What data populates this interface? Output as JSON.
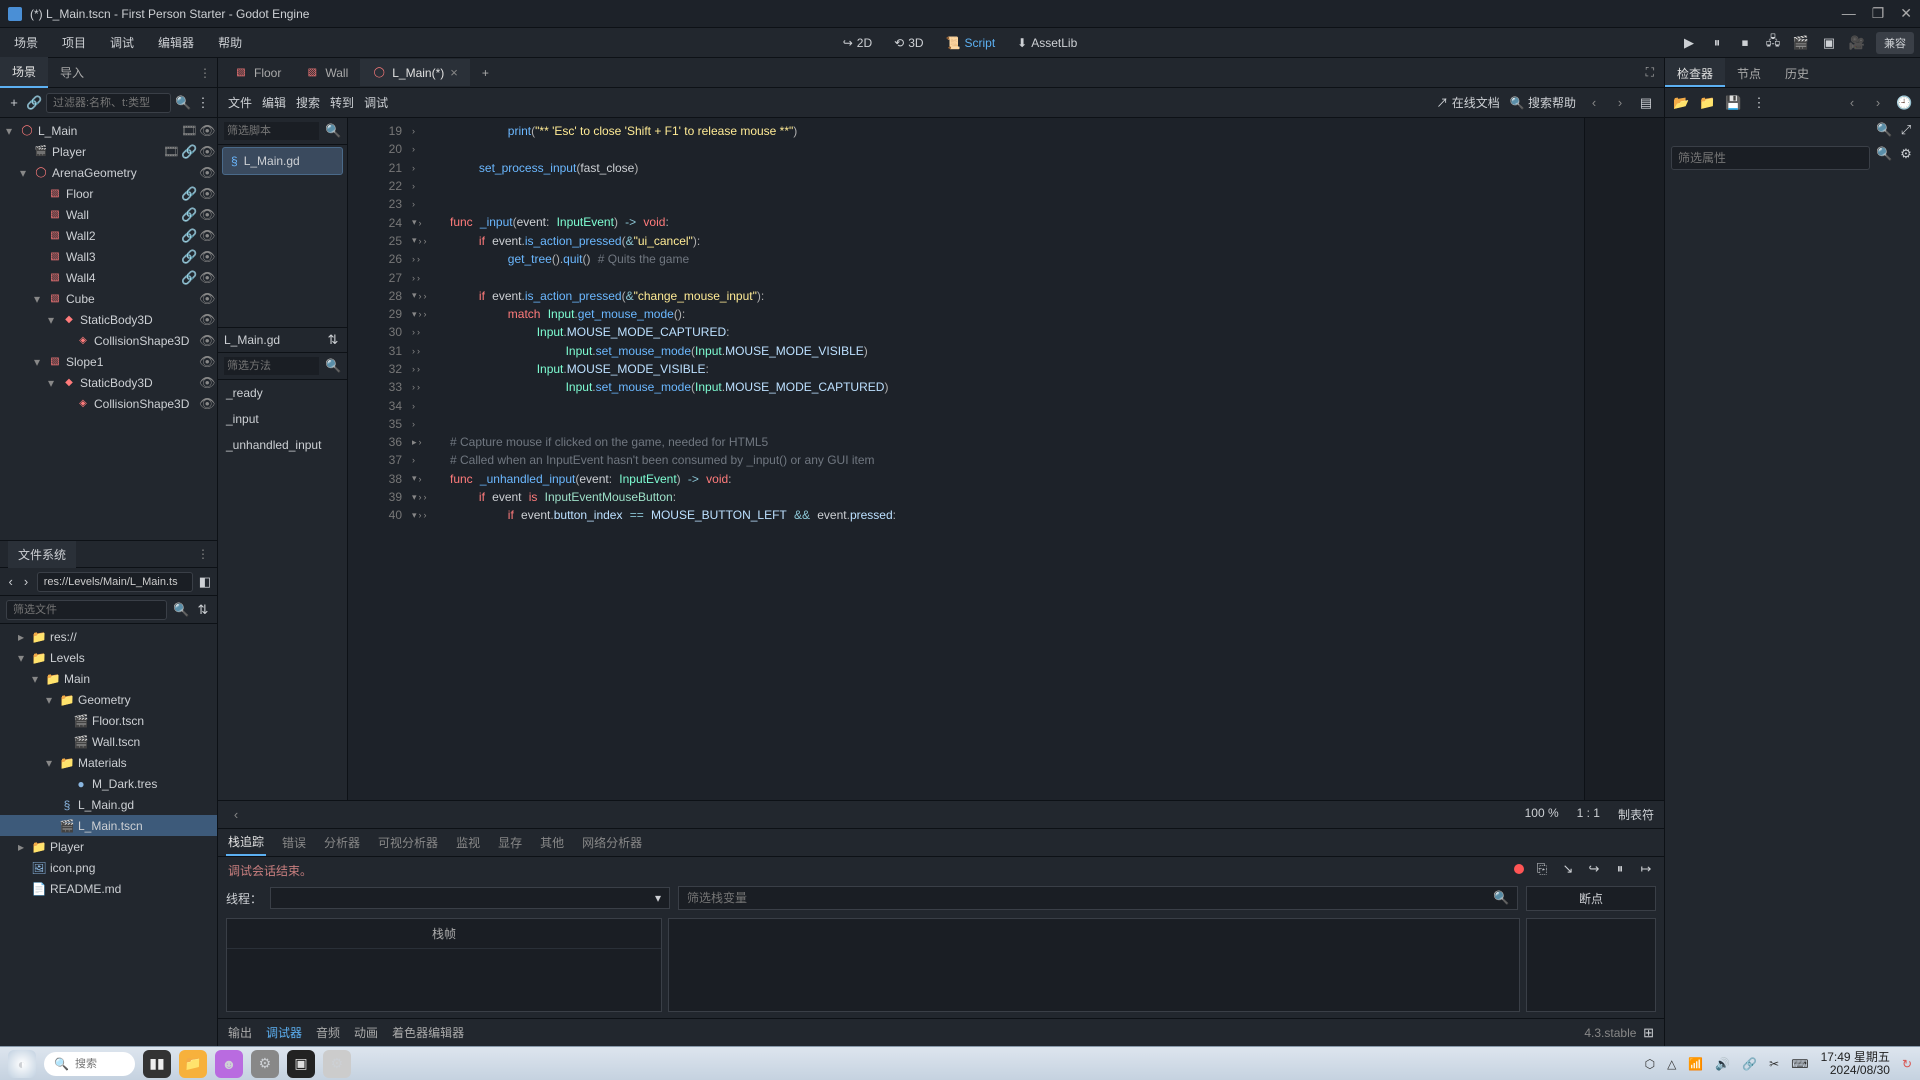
{
  "window": {
    "title": "(*) L_Main.tscn - First Person Starter - Godot Engine"
  },
  "top_menu": [
    "场景",
    "项目",
    "调试",
    "编辑器",
    "帮助"
  ],
  "viewport_buttons": {
    "v2d": "2D",
    "v3d": "3D",
    "script": "Script",
    "assetlib": "AssetLib"
  },
  "compat": "兼容",
  "left": {
    "tabs": {
      "scene": "场景",
      "import": "导入"
    },
    "filter_ph": "过滤器:名称、t:类型",
    "scene_tree": [
      {
        "indent": 0,
        "fold": "▾",
        "icon": "◯",
        "name": "L_Main",
        "ricons": [
          "🎞",
          "👁"
        ]
      },
      {
        "indent": 1,
        "fold": "",
        "icon": "🎬",
        "name": "Player",
        "ricons": [
          "🎞",
          "🔗",
          "👁"
        ]
      },
      {
        "indent": 1,
        "fold": "▾",
        "icon": "◯",
        "name": "ArenaGeometry",
        "ricons": [
          "👁"
        ]
      },
      {
        "indent": 2,
        "fold": "",
        "icon": "▧",
        "name": "Floor",
        "ricons": [
          "🔗",
          "👁"
        ]
      },
      {
        "indent": 2,
        "fold": "",
        "icon": "▧",
        "name": "Wall",
        "ricons": [
          "🔗",
          "👁"
        ]
      },
      {
        "indent": 2,
        "fold": "",
        "icon": "▧",
        "name": "Wall2",
        "ricons": [
          "🔗",
          "👁"
        ]
      },
      {
        "indent": 2,
        "fold": "",
        "icon": "▧",
        "name": "Wall3",
        "ricons": [
          "🔗",
          "👁"
        ]
      },
      {
        "indent": 2,
        "fold": "",
        "icon": "▧",
        "name": "Wall4",
        "ricons": [
          "🔗",
          "👁"
        ]
      },
      {
        "indent": 2,
        "fold": "▾",
        "icon": "▧",
        "name": "Cube",
        "ricons": [
          "👁"
        ]
      },
      {
        "indent": 3,
        "fold": "▾",
        "icon": "◆",
        "name": "StaticBody3D",
        "ricons": [
          "👁"
        ]
      },
      {
        "indent": 4,
        "fold": "",
        "icon": "◈",
        "name": "CollisionShape3D",
        "ricons": [
          "👁"
        ]
      },
      {
        "indent": 2,
        "fold": "▾",
        "icon": "▧",
        "name": "Slope1",
        "ricons": [
          "👁"
        ]
      },
      {
        "indent": 3,
        "fold": "▾",
        "icon": "◆",
        "name": "StaticBody3D",
        "ricons": [
          "👁"
        ]
      },
      {
        "indent": 4,
        "fold": "",
        "icon": "◈",
        "name": "CollisionShape3D",
        "ricons": [
          "👁"
        ]
      }
    ],
    "fs_tab": "文件系统",
    "fs_path": "res://Levels/Main/L_Main.ts",
    "fs_filter_ph": "筛选文件",
    "fs_tree": [
      {
        "indent": 0,
        "fold": "▸",
        "icon": "📁",
        "name": "res://"
      },
      {
        "indent": 0,
        "fold": "▾",
        "icon": "📁",
        "name": "Levels"
      },
      {
        "indent": 1,
        "fold": "▾",
        "icon": "📁",
        "name": "Main"
      },
      {
        "indent": 2,
        "fold": "▾",
        "icon": "📁",
        "name": "Geometry"
      },
      {
        "indent": 3,
        "fold": "",
        "icon": "🎬",
        "name": "Floor.tscn"
      },
      {
        "indent": 3,
        "fold": "",
        "icon": "🎬",
        "name": "Wall.tscn"
      },
      {
        "indent": 2,
        "fold": "▾",
        "icon": "📁",
        "name": "Materials"
      },
      {
        "indent": 3,
        "fold": "",
        "icon": "●",
        "name": "M_Dark.tres"
      },
      {
        "indent": 2,
        "fold": "",
        "icon": "§",
        "name": "L_Main.gd"
      },
      {
        "indent": 2,
        "fold": "",
        "icon": "🎬",
        "name": "L_Main.tscn",
        "sel": true
      },
      {
        "indent": 0,
        "fold": "▸",
        "icon": "📁",
        "name": "Player"
      },
      {
        "indent": 0,
        "fold": "",
        "icon": "🖼",
        "name": "icon.png"
      },
      {
        "indent": 0,
        "fold": "",
        "icon": "📄",
        "name": "README.md"
      }
    ]
  },
  "center": {
    "scene_tabs": [
      {
        "icon": "▧",
        "label": "Floor"
      },
      {
        "icon": "▧",
        "label": "Wall"
      },
      {
        "icon": "◯",
        "label": "L_Main(*)",
        "active": true,
        "close": true
      }
    ],
    "script_menu": [
      "文件",
      "编辑",
      "搜索",
      "转到",
      "调试"
    ],
    "online_doc": "在线文档",
    "search_help": "搜索帮助",
    "filter_scripts_ph": "筛选脚本",
    "script_item": "L_Main.gd",
    "current_script": "L_Main.gd",
    "filter_methods_ph": "筛选方法",
    "methods": [
      "_ready",
      "_input",
      "_unhandled_input"
    ],
    "status": {
      "zoom": "100 %",
      "pos": "1 :    1",
      "tabs": "制表符"
    }
  },
  "code_lines": [
    19,
    20,
    21,
    22,
    23,
    24,
    25,
    26,
    27,
    28,
    29,
    30,
    31,
    32,
    33,
    34,
    35,
    36,
    37,
    38,
    39,
    40
  ],
  "debugger": {
    "tabs": [
      "栈追踪",
      "错误",
      "分析器",
      "可视分析器",
      "监视",
      "显存",
      "其他",
      "网络分析器"
    ],
    "msg": "调试会话结束。",
    "thread_lbl": "线程：",
    "filter_stack_ph": "筛选栈变量",
    "breakpoints": "断点",
    "stack_frame": "栈帧"
  },
  "bottom_tabs": [
    "输出",
    "调试器",
    "音频",
    "动画",
    "着色器编辑器"
  ],
  "version": "4.3.stable",
  "inspector": {
    "tabs": [
      "检查器",
      "节点",
      "历史"
    ],
    "filter_ph": "筛选属性"
  },
  "taskbar": {
    "search_ph": "搜索",
    "time": "17:49 星期五",
    "date": "2024/08/30"
  }
}
